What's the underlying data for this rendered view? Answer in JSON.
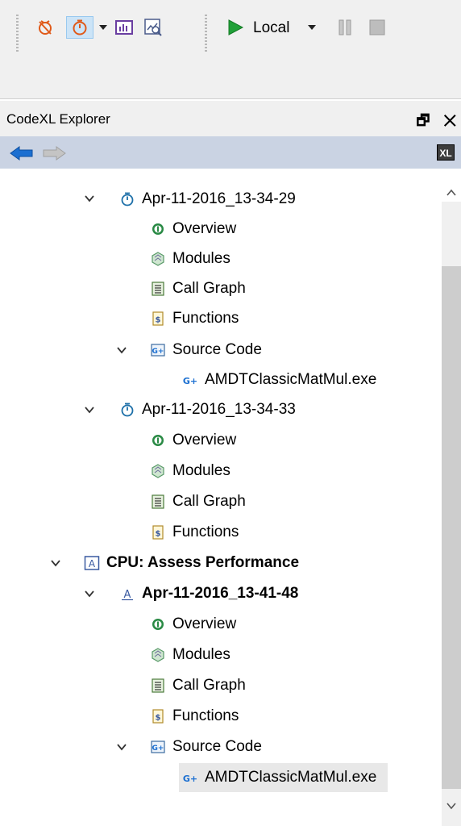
{
  "toolbar": {
    "mode_label": "Local",
    "buttons": [
      "stop-profiling-icon",
      "profile-timer-icon",
      "memory-icon",
      "analyze-icon",
      "start-icon",
      "pause-icon",
      "stop-icon"
    ]
  },
  "panel": {
    "title": "CodeXL Explorer",
    "logo_text": "XL"
  },
  "tree": {
    "session1": {
      "label": "Apr-11-2016_13-34-29",
      "children": {
        "overview": "Overview",
        "modules": "Modules",
        "call_graph": "Call Graph",
        "functions": "Functions",
        "source_code": "Source Code",
        "source_file": "AMDTClassicMatMul.exe"
      }
    },
    "session2": {
      "label": "Apr-11-2016_13-34-33",
      "children": {
        "overview": "Overview",
        "modules": "Modules",
        "call_graph": "Call Graph",
        "functions": "Functions"
      }
    },
    "assess": {
      "label": "CPU: Assess Performance"
    },
    "session3": {
      "label": "Apr-11-2016_13-41-48",
      "children": {
        "overview": "Overview",
        "modules": "Modules",
        "call_graph": "Call Graph",
        "functions": "Functions",
        "source_code": "Source Code",
        "source_file": "AMDTClassicMatMul.exe"
      }
    }
  },
  "colors": {
    "nav_bar": "#cad3e3",
    "accent_blue": "#1b6fd1",
    "toolbar_bg": "#f0f0f0"
  }
}
